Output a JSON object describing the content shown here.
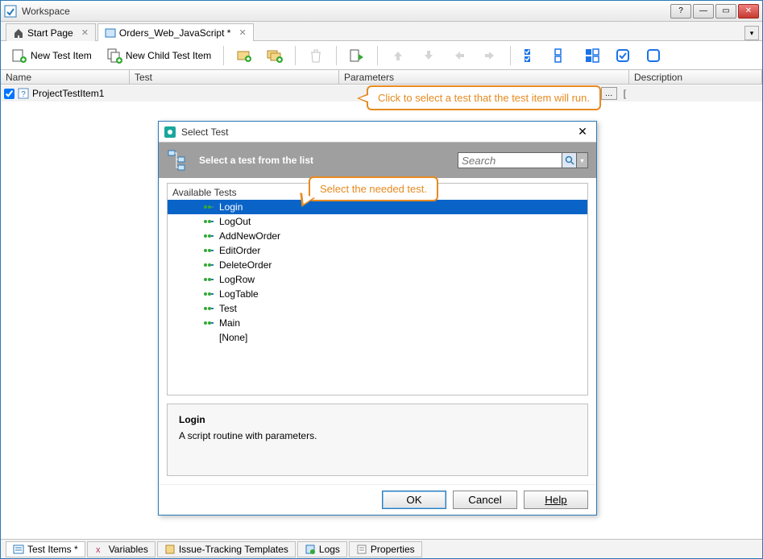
{
  "window": {
    "title": "Workspace"
  },
  "tabs": {
    "start": "Start Page",
    "active": "Orders_Web_JavaScript *"
  },
  "toolbar": {
    "new_test_item": "New Test Item",
    "new_child_test_item": "New Child Test Item"
  },
  "grid": {
    "headers": {
      "name": "Name",
      "test": "Test",
      "params": "Parameters",
      "desc": "Description"
    },
    "row": {
      "name": "ProjectTestItem1",
      "params_lead": "["
    }
  },
  "callouts": {
    "c1": "Click to select a test that the test item will run.",
    "c2": "Select the needed test."
  },
  "dialog": {
    "title": "Select Test",
    "banner": "Select a test from the list",
    "search_placeholder": "Search",
    "available_label": "Available Tests",
    "items": [
      "Login",
      "LogOut",
      "AddNewOrder",
      "EditOrder",
      "DeleteOrder",
      "LogRow",
      "LogTable",
      "Test",
      "Main"
    ],
    "none_label": "[None]",
    "desc": {
      "name": "Login",
      "text": "A script routine with parameters."
    },
    "buttons": {
      "ok": "OK",
      "cancel": "Cancel",
      "help": "Help"
    }
  },
  "bottom_tabs": {
    "test_items": "Test Items *",
    "variables": "Variables",
    "issue": "Issue-Tracking Templates",
    "logs": "Logs",
    "properties": "Properties"
  }
}
